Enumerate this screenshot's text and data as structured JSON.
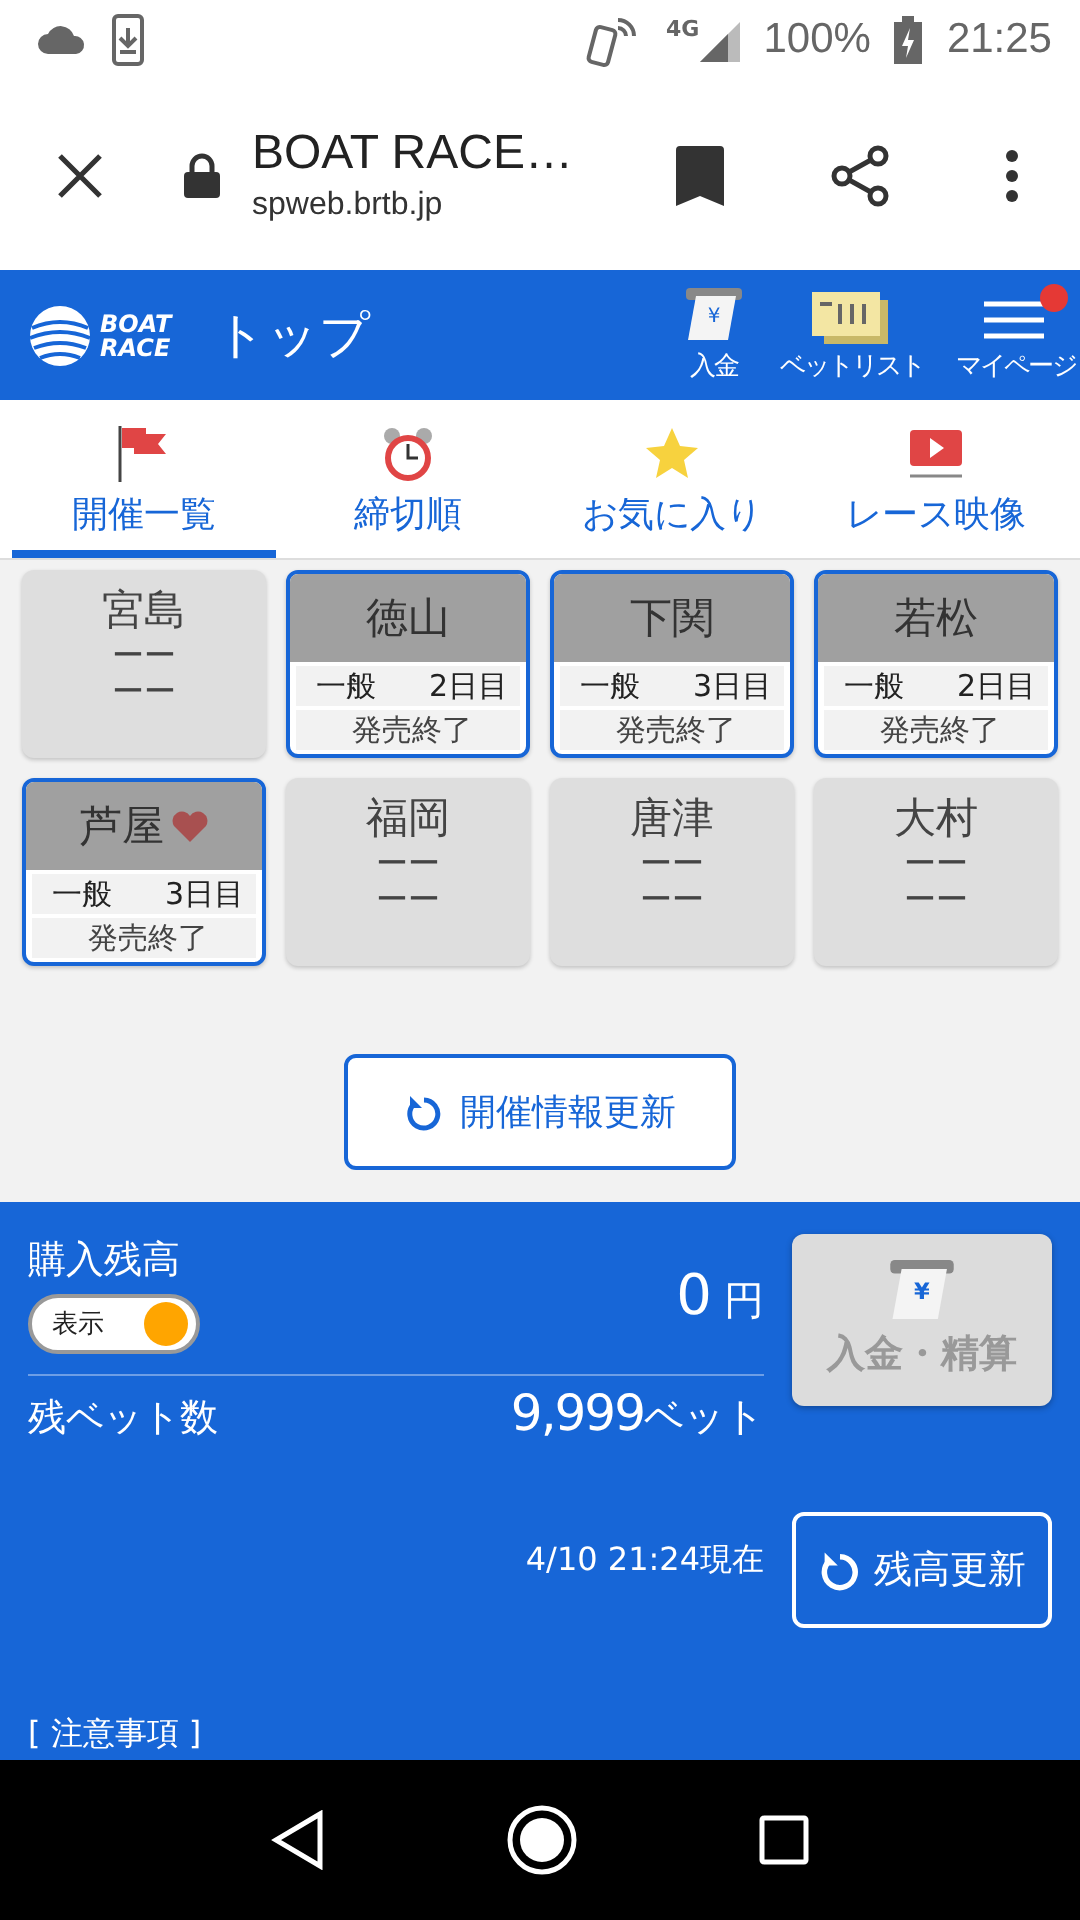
{
  "status_bar": {
    "network": "4G",
    "battery": "100%",
    "time": "21:25"
  },
  "browser": {
    "title": "BOAT RACE…",
    "url": "spweb.brtb.jp"
  },
  "header": {
    "logo_line1": "BOAT",
    "logo_line2": "RACE",
    "title": "トップ",
    "actions": [
      {
        "kind": "deposit",
        "label": "入金",
        "symbol": "¥",
        "badge": false
      },
      {
        "kind": "betlist",
        "label": "ベットリスト",
        "badge": false
      },
      {
        "kind": "menu",
        "label": "マイページ",
        "badge": true
      }
    ]
  },
  "tabs": [
    {
      "kind": "flag",
      "label": "開催一覧",
      "selected": true
    },
    {
      "kind": "clock",
      "label": "締切順",
      "selected": false
    },
    {
      "kind": "star",
      "label": "お気に入り",
      "selected": false
    },
    {
      "kind": "video",
      "label": "レース映像",
      "selected": false
    }
  ],
  "venues": [
    {
      "name": "宮島",
      "active": false,
      "favorite": false,
      "line1": "ーー",
      "line2": "ーー"
    },
    {
      "name": "徳山",
      "active": true,
      "favorite": false,
      "grade": "一般",
      "day": "2日目",
      "status": "発売終了"
    },
    {
      "name": "下関",
      "active": true,
      "favorite": false,
      "grade": "一般",
      "day": "3日目",
      "status": "発売終了"
    },
    {
      "name": "若松",
      "active": true,
      "favorite": false,
      "grade": "一般",
      "day": "2日目",
      "status": "発売終了"
    },
    {
      "name": "芦屋",
      "active": true,
      "favorite": true,
      "grade": "一般",
      "day": "3日目",
      "status": "発売終了"
    },
    {
      "name": "福岡",
      "active": false,
      "favorite": false,
      "line1": "ーー",
      "line2": "ーー"
    },
    {
      "name": "唐津",
      "active": false,
      "favorite": false,
      "line1": "ーー",
      "line2": "ーー"
    },
    {
      "name": "大村",
      "active": false,
      "favorite": false,
      "line1": "ーー",
      "line2": "ーー"
    }
  ],
  "refresh_button": "開催情報更新",
  "balance": {
    "label": "購入残高",
    "toggle": {
      "label": "表示",
      "on": true
    },
    "amount": "0",
    "unit": "円",
    "bets_label": "残ベット数",
    "bets": "9,999",
    "bets_unit": "ベット",
    "timestamp": "4/10 21:24現在",
    "deposit_symbol": "¥",
    "deposit_button": "入金・精算",
    "refresh_button": "残高更新",
    "notice": "[ 注意事項 ]"
  }
}
